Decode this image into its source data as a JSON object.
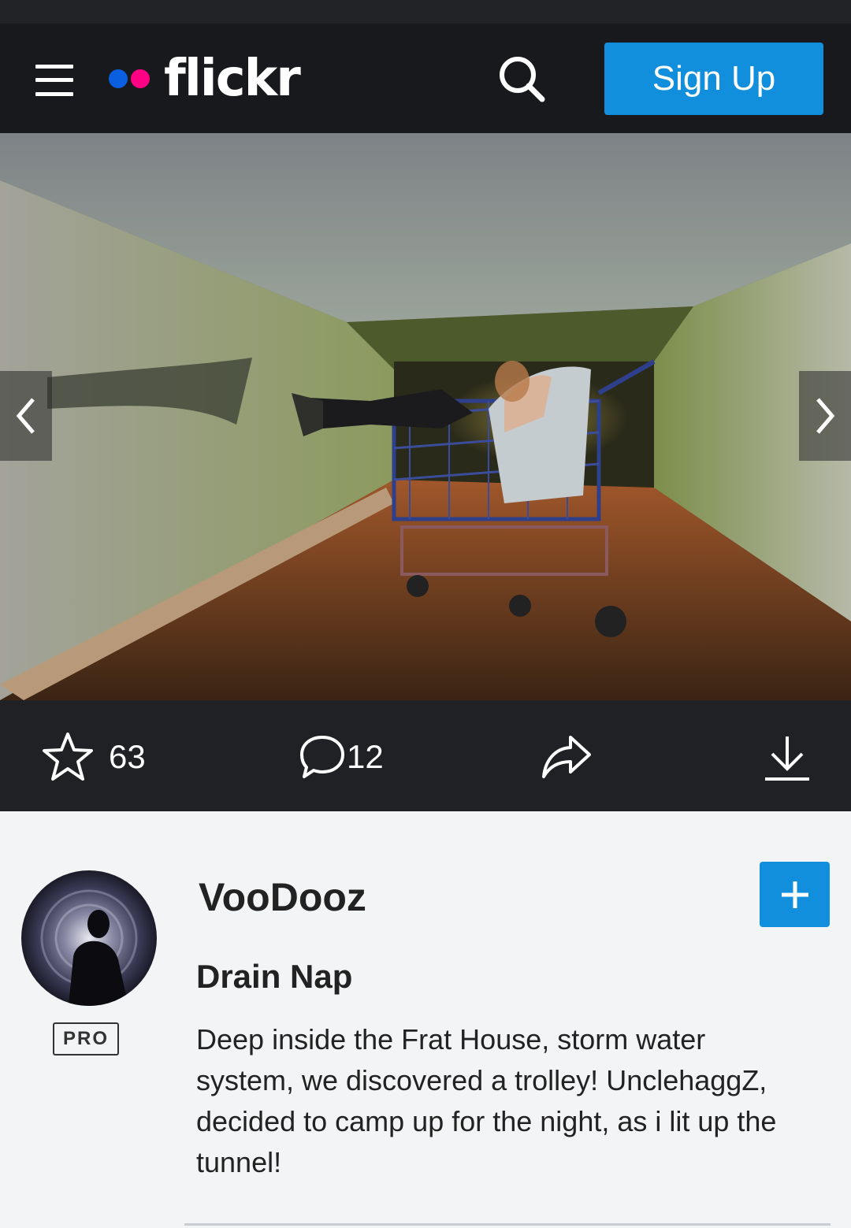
{
  "header": {
    "menu_icon": "hamburger-menu-icon",
    "logo_text": "flickr",
    "logo_colors": {
      "blue": "#0a5fe0",
      "pink": "#ff0084"
    },
    "search_icon": "search-icon",
    "signup_label": "Sign Up",
    "accent_color": "#128fdc"
  },
  "photo": {
    "prev_icon": "chevron-left-icon",
    "next_icon": "chevron-right-icon"
  },
  "actions": {
    "favorites_icon": "star-icon",
    "favorites_count": "63",
    "comments_icon": "comment-icon",
    "comments_count": "12",
    "share_icon": "share-icon",
    "download_icon": "download-icon"
  },
  "owner": {
    "username": "VooDooz",
    "badge": "PRO",
    "follow_icon": "plus-icon"
  },
  "post": {
    "title": "Drain Nap",
    "description": "Deep inside the Frat House, storm water system, we discovered a trolley! UnclehaggZ, decided to camp up for the night, as i lit up the tunnel!"
  }
}
